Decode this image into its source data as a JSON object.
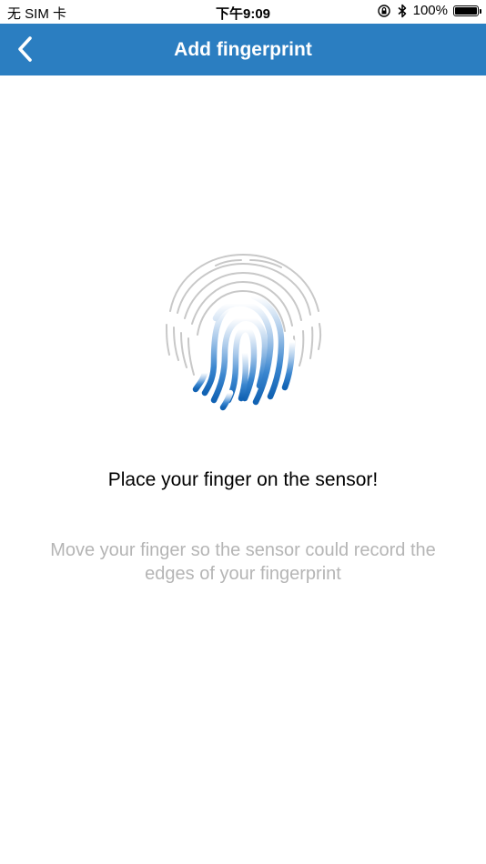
{
  "status_bar": {
    "carrier": "无 SIM 卡",
    "time": "下午9:09",
    "battery_percent": "100%",
    "battery_level": 1.0
  },
  "nav": {
    "title": "Add fingerprint",
    "back_icon": "chevron-left-icon"
  },
  "main": {
    "icon": "fingerprint-icon",
    "headline": "Place your finger on the sensor!",
    "hint": "Move your finger so the sensor could record the edges of your fingerprint"
  },
  "colors": {
    "nav_background": "#2b7ec1",
    "accent_blue": "#1565b5",
    "hint_text": "#b5b5b5",
    "fingerprint_outline": "#c8c8c8"
  }
}
